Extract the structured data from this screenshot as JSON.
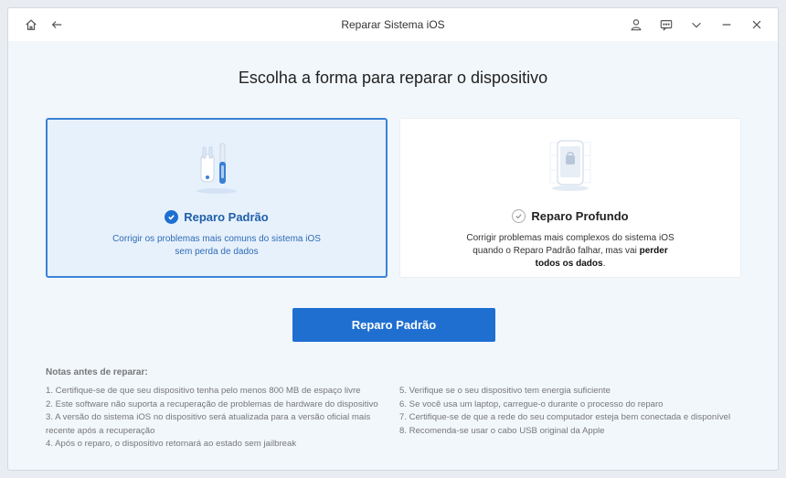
{
  "window": {
    "title": "Reparar Sistema iOS"
  },
  "heading": "Escolha a forma para reparar o dispositivo",
  "options": [
    {
      "title": "Reparo Padrão",
      "desc_line1": "Corrigir os problemas mais comuns do sistema iOS",
      "desc_line2": "sem perda de dados",
      "selected": true
    },
    {
      "title": "Reparo Profundo",
      "desc_line1": "Corrigir problemas mais complexos do sistema iOS",
      "desc_line2_pre": "quando o Reparo Padrão falhar, mas vai ",
      "desc_line2_bold": "perder",
      "desc_line3_bold": "todos os dados",
      "desc_line3_post": ".",
      "selected": false
    }
  ],
  "action_button": "Reparo Padrão",
  "notes": {
    "title": "Notas antes de reparar:",
    "left": [
      "1.  Certifique-se de que seu dispositivo tenha pelo menos 800 MB de espaço livre",
      "2.  Este software não suporta a recuperação de problemas de hardware do dispositivo",
      "3.  A versão do sistema iOS no dispositivo será atualizada para a versão oficial mais recente após a recuperação",
      "4.  Após o reparo, o dispositivo retornará ao estado sem jailbreak"
    ],
    "right": [
      "5.  Verifique se o seu dispositivo tem energia suficiente",
      "6.  Se você usa um laptop, carregue-o durante o processo do reparo",
      "7.  Certifique-se de que a rede do seu computador esteja bem conectada e disponível",
      "8.  Recomenda-se usar o cabo USB original da Apple"
    ]
  },
  "icons": {
    "home": "home-icon",
    "back": "back-arrow-icon",
    "account": "user-icon",
    "feedback": "feedback-icon",
    "menu": "chevron-down-icon",
    "minimize": "minimize-icon",
    "close": "close-icon"
  },
  "colors": {
    "accent": "#1f6fd1",
    "selected_border": "#3b82d6",
    "selected_bg": "#e7f1fc"
  }
}
